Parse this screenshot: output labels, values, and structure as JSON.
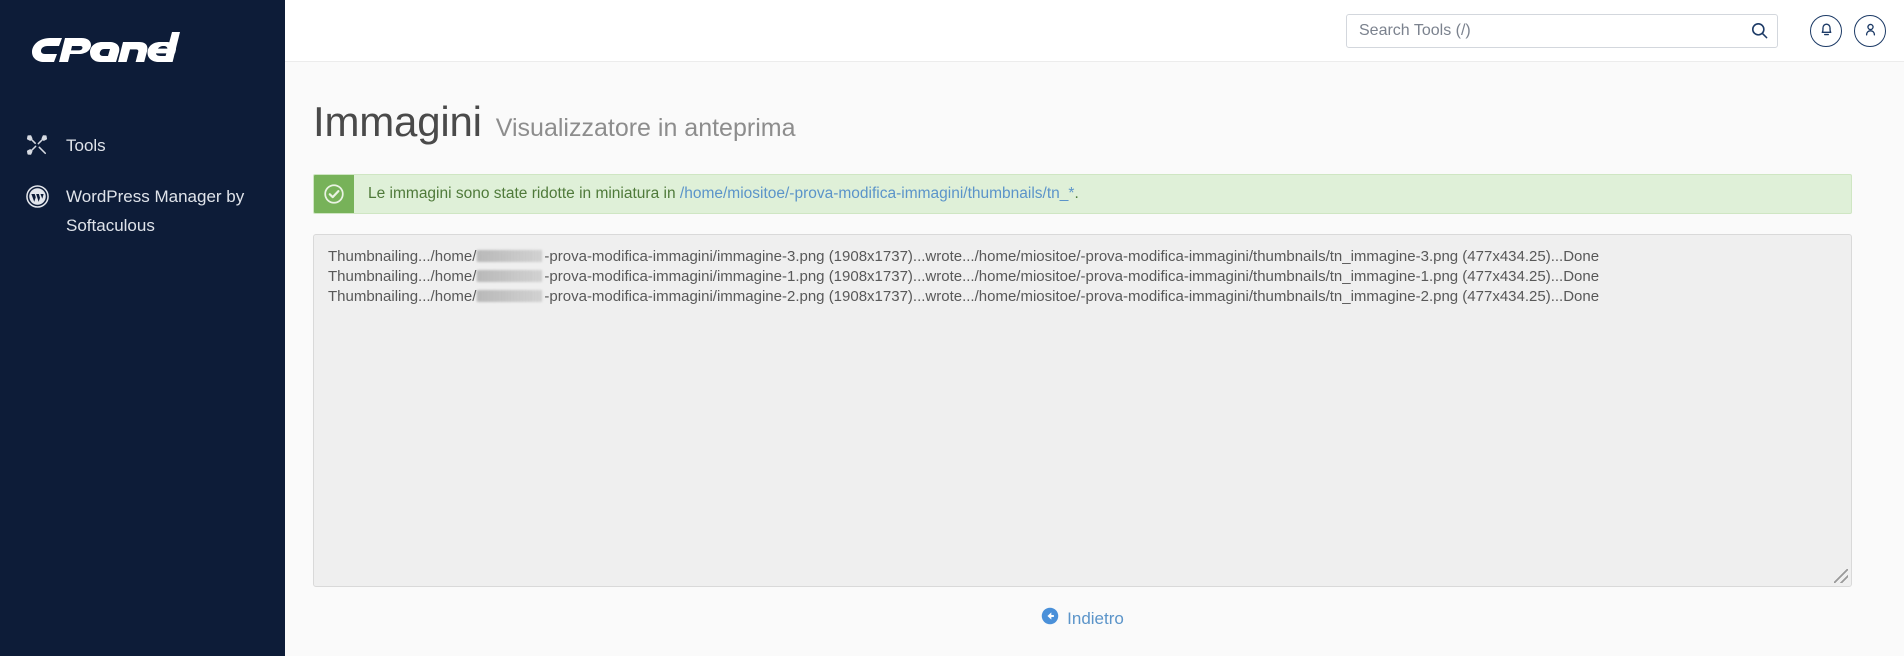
{
  "sidebar": {
    "brand": "cPanel",
    "items": [
      {
        "label": "Tools",
        "icon": "tools-icon"
      },
      {
        "label": "WordPress Manager by Softaculous",
        "icon": "wordpress-icon"
      }
    ]
  },
  "header": {
    "search": {
      "placeholder": "Search Tools (/)",
      "value": "",
      "icon": "search-icon"
    },
    "notifications_icon": "bell-icon",
    "account_icon": "user-icon"
  },
  "page": {
    "title": "Immagini",
    "subtitle": "Visualizzatore in anteprima"
  },
  "alert": {
    "icon": "check-circle-icon",
    "text_before": "Le immagini sono state ridotte in miniatura in",
    "link": "/home/miositoe/-prova-modifica-immagini/thumbnails/tn_*",
    "text_after": ".",
    "bg_color": "#dff0d8",
    "icon_bg_color": "#77b259",
    "text_color": "#4f7a3a",
    "link_color": "#5b94c9"
  },
  "log": {
    "lines": [
      {
        "prefix": "Thumbnailing.../home/",
        "redacted": true,
        "suffix": "-prova-modifica-immagini/immagine-3.png (1908x1737)...wrote.../home/miositoe/-prova-modifica-immagini/thumbnails/tn_immagine-3.png (477x434.25)...Done"
      },
      {
        "prefix": "Thumbnailing.../home/",
        "redacted": true,
        "suffix": "-prova-modifica-immagini/immagine-1.png (1908x1737)...wrote.../home/miositoe/-prova-modifica-immagini/thumbnails/tn_immagine-1.png (477x434.25)...Done"
      },
      {
        "prefix": "Thumbnailing.../home/",
        "redacted": true,
        "suffix": "-prova-modifica-immagini/immagine-2.png (1908x1737)...wrote.../home/miositoe/-prova-modifica-immagini/thumbnails/tn_immagine-2.png (477x434.25)...Done"
      }
    ]
  },
  "footer": {
    "back_label": "Indietro",
    "back_icon": "arrow-circle-left-icon"
  }
}
